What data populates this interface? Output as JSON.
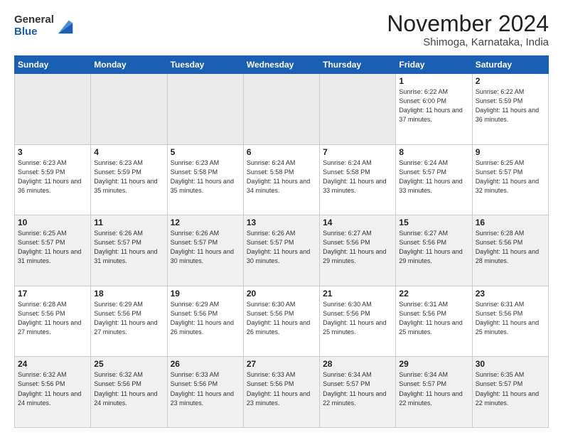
{
  "header": {
    "logo": {
      "general": "General",
      "blue": "Blue"
    },
    "title": "November 2024",
    "subtitle": "Shimoga, Karnataka, India"
  },
  "calendar": {
    "days_of_week": [
      "Sunday",
      "Monday",
      "Tuesday",
      "Wednesday",
      "Thursday",
      "Friday",
      "Saturday"
    ],
    "weeks": [
      [
        {
          "day": "",
          "empty": true
        },
        {
          "day": "",
          "empty": true
        },
        {
          "day": "",
          "empty": true
        },
        {
          "day": "",
          "empty": true
        },
        {
          "day": "",
          "empty": true
        },
        {
          "day": "1",
          "sunrise": "Sunrise: 6:22 AM",
          "sunset": "Sunset: 6:00 PM",
          "daylight": "Daylight: 11 hours and 37 minutes."
        },
        {
          "day": "2",
          "sunrise": "Sunrise: 6:22 AM",
          "sunset": "Sunset: 5:59 PM",
          "daylight": "Daylight: 11 hours and 36 minutes."
        }
      ],
      [
        {
          "day": "3",
          "sunrise": "Sunrise: 6:23 AM",
          "sunset": "Sunset: 5:59 PM",
          "daylight": "Daylight: 11 hours and 36 minutes."
        },
        {
          "day": "4",
          "sunrise": "Sunrise: 6:23 AM",
          "sunset": "Sunset: 5:59 PM",
          "daylight": "Daylight: 11 hours and 35 minutes."
        },
        {
          "day": "5",
          "sunrise": "Sunrise: 6:23 AM",
          "sunset": "Sunset: 5:58 PM",
          "daylight": "Daylight: 11 hours and 35 minutes."
        },
        {
          "day": "6",
          "sunrise": "Sunrise: 6:24 AM",
          "sunset": "Sunset: 5:58 PM",
          "daylight": "Daylight: 11 hours and 34 minutes."
        },
        {
          "day": "7",
          "sunrise": "Sunrise: 6:24 AM",
          "sunset": "Sunset: 5:58 PM",
          "daylight": "Daylight: 11 hours and 33 minutes."
        },
        {
          "day": "8",
          "sunrise": "Sunrise: 6:24 AM",
          "sunset": "Sunset: 5:57 PM",
          "daylight": "Daylight: 11 hours and 33 minutes."
        },
        {
          "day": "9",
          "sunrise": "Sunrise: 6:25 AM",
          "sunset": "Sunset: 5:57 PM",
          "daylight": "Daylight: 11 hours and 32 minutes."
        }
      ],
      [
        {
          "day": "10",
          "sunrise": "Sunrise: 6:25 AM",
          "sunset": "Sunset: 5:57 PM",
          "daylight": "Daylight: 11 hours and 31 minutes."
        },
        {
          "day": "11",
          "sunrise": "Sunrise: 6:26 AM",
          "sunset": "Sunset: 5:57 PM",
          "daylight": "Daylight: 11 hours and 31 minutes."
        },
        {
          "day": "12",
          "sunrise": "Sunrise: 6:26 AM",
          "sunset": "Sunset: 5:57 PM",
          "daylight": "Daylight: 11 hours and 30 minutes."
        },
        {
          "day": "13",
          "sunrise": "Sunrise: 6:26 AM",
          "sunset": "Sunset: 5:57 PM",
          "daylight": "Daylight: 11 hours and 30 minutes."
        },
        {
          "day": "14",
          "sunrise": "Sunrise: 6:27 AM",
          "sunset": "Sunset: 5:56 PM",
          "daylight": "Daylight: 11 hours and 29 minutes."
        },
        {
          "day": "15",
          "sunrise": "Sunrise: 6:27 AM",
          "sunset": "Sunset: 5:56 PM",
          "daylight": "Daylight: 11 hours and 29 minutes."
        },
        {
          "day": "16",
          "sunrise": "Sunrise: 6:28 AM",
          "sunset": "Sunset: 5:56 PM",
          "daylight": "Daylight: 11 hours and 28 minutes."
        }
      ],
      [
        {
          "day": "17",
          "sunrise": "Sunrise: 6:28 AM",
          "sunset": "Sunset: 5:56 PM",
          "daylight": "Daylight: 11 hours and 27 minutes."
        },
        {
          "day": "18",
          "sunrise": "Sunrise: 6:29 AM",
          "sunset": "Sunset: 5:56 PM",
          "daylight": "Daylight: 11 hours and 27 minutes."
        },
        {
          "day": "19",
          "sunrise": "Sunrise: 6:29 AM",
          "sunset": "Sunset: 5:56 PM",
          "daylight": "Daylight: 11 hours and 26 minutes."
        },
        {
          "day": "20",
          "sunrise": "Sunrise: 6:30 AM",
          "sunset": "Sunset: 5:56 PM",
          "daylight": "Daylight: 11 hours and 26 minutes."
        },
        {
          "day": "21",
          "sunrise": "Sunrise: 6:30 AM",
          "sunset": "Sunset: 5:56 PM",
          "daylight": "Daylight: 11 hours and 25 minutes."
        },
        {
          "day": "22",
          "sunrise": "Sunrise: 6:31 AM",
          "sunset": "Sunset: 5:56 PM",
          "daylight": "Daylight: 11 hours and 25 minutes."
        },
        {
          "day": "23",
          "sunrise": "Sunrise: 6:31 AM",
          "sunset": "Sunset: 5:56 PM",
          "daylight": "Daylight: 11 hours and 25 minutes."
        }
      ],
      [
        {
          "day": "24",
          "sunrise": "Sunrise: 6:32 AM",
          "sunset": "Sunset: 5:56 PM",
          "daylight": "Daylight: 11 hours and 24 minutes."
        },
        {
          "day": "25",
          "sunrise": "Sunrise: 6:32 AM",
          "sunset": "Sunset: 5:56 PM",
          "daylight": "Daylight: 11 hours and 24 minutes."
        },
        {
          "day": "26",
          "sunrise": "Sunrise: 6:33 AM",
          "sunset": "Sunset: 5:56 PM",
          "daylight": "Daylight: 11 hours and 23 minutes."
        },
        {
          "day": "27",
          "sunrise": "Sunrise: 6:33 AM",
          "sunset": "Sunset: 5:56 PM",
          "daylight": "Daylight: 11 hours and 23 minutes."
        },
        {
          "day": "28",
          "sunrise": "Sunrise: 6:34 AM",
          "sunset": "Sunset: 5:57 PM",
          "daylight": "Daylight: 11 hours and 22 minutes."
        },
        {
          "day": "29",
          "sunrise": "Sunrise: 6:34 AM",
          "sunset": "Sunset: 5:57 PM",
          "daylight": "Daylight: 11 hours and 22 minutes."
        },
        {
          "day": "30",
          "sunrise": "Sunrise: 6:35 AM",
          "sunset": "Sunset: 5:57 PM",
          "daylight": "Daylight: 11 hours and 22 minutes."
        }
      ]
    ]
  }
}
